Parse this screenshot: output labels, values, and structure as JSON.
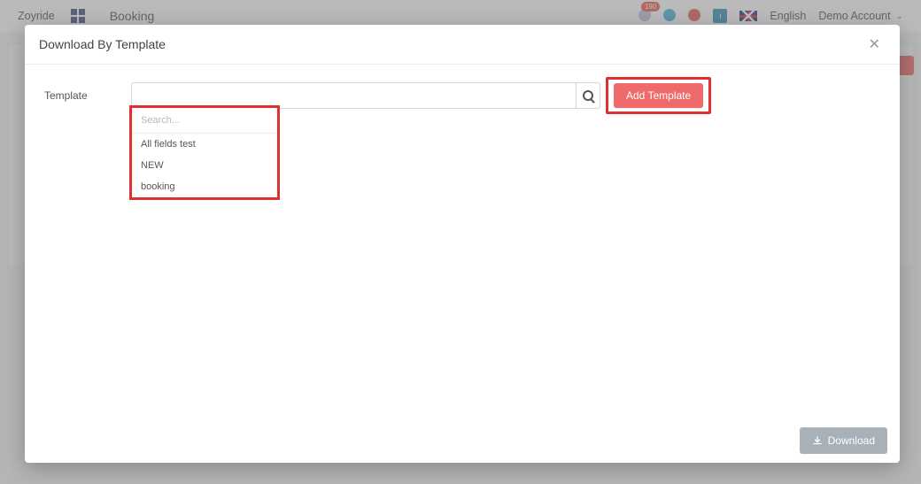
{
  "topbar": {
    "brand": "Zoyride",
    "page_title": "Booking",
    "notif_count": "190",
    "language": "English",
    "account_label": "Demo Account"
  },
  "modal": {
    "title": "Download By Template",
    "template_label": "Template",
    "template_value": "",
    "add_button": "Add Template",
    "download_button": "Download"
  },
  "dropdown": {
    "search_placeholder": "Search...",
    "items": [
      "All fields test",
      "NEW",
      "booking"
    ]
  }
}
